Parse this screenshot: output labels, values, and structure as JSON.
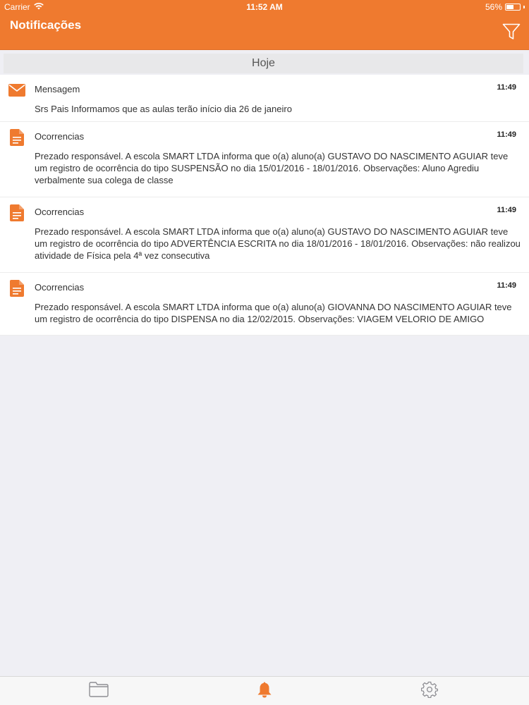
{
  "status_bar": {
    "carrier": "Carrier",
    "time": "11:52 AM",
    "battery": "56%",
    "battery_level": 0.56
  },
  "nav": {
    "title": "Notificações",
    "filter_icon": "filter-icon"
  },
  "section": {
    "label": "Hoje"
  },
  "notifications": [
    {
      "icon": "envelope-icon",
      "category": "Mensagem",
      "time": "11:49",
      "body": "Srs Pais Informamos que as aulas terão início dia 26 de janeiro"
    },
    {
      "icon": "document-icon",
      "category": "Ocorrencias",
      "time": "11:49",
      "body": "Prezado responsável. A escola SMART LTDA informa que o(a) aluno(a) GUSTAVO DO NASCIMENTO AGUIAR teve um registro de ocorrência do tipo SUSPENSÃO no dia 15/01/2016 - 18/01/2016. Observações: Aluno Agrediu verbalmente sua colega de classe"
    },
    {
      "icon": "document-icon",
      "category": "Ocorrencias",
      "time": "11:49",
      "body": "Prezado responsável. A escola SMART LTDA informa que o(a) aluno(a) GUSTAVO DO NASCIMENTO AGUIAR teve um registro de ocorrência do tipo ADVERTÊNCIA ESCRITA no dia 18/01/2016 - 18/01/2016. Observações: não realizou atividade de Física pela 4ª vez consecutiva"
    },
    {
      "icon": "document-icon",
      "category": "Ocorrencias",
      "time": "11:49",
      "body": "Prezado responsável. A escola SMART LTDA informa que o(a) aluno(a) GIOVANNA DO NASCIMENTO AGUIAR teve um registro de ocorrência do tipo DISPENSA no dia 12/02/2015. Observações: VIAGEM VELORIO DE AMIGO"
    }
  ],
  "tab_bar": {
    "tabs": [
      {
        "icon": "folder-icon",
        "active": false
      },
      {
        "icon": "bell-icon",
        "active": true
      },
      {
        "icon": "gear-icon",
        "active": false
      }
    ]
  },
  "colors": {
    "accent": "#ef7a2f",
    "background": "#efeff4",
    "tab_inactive": "#8e8e93"
  }
}
